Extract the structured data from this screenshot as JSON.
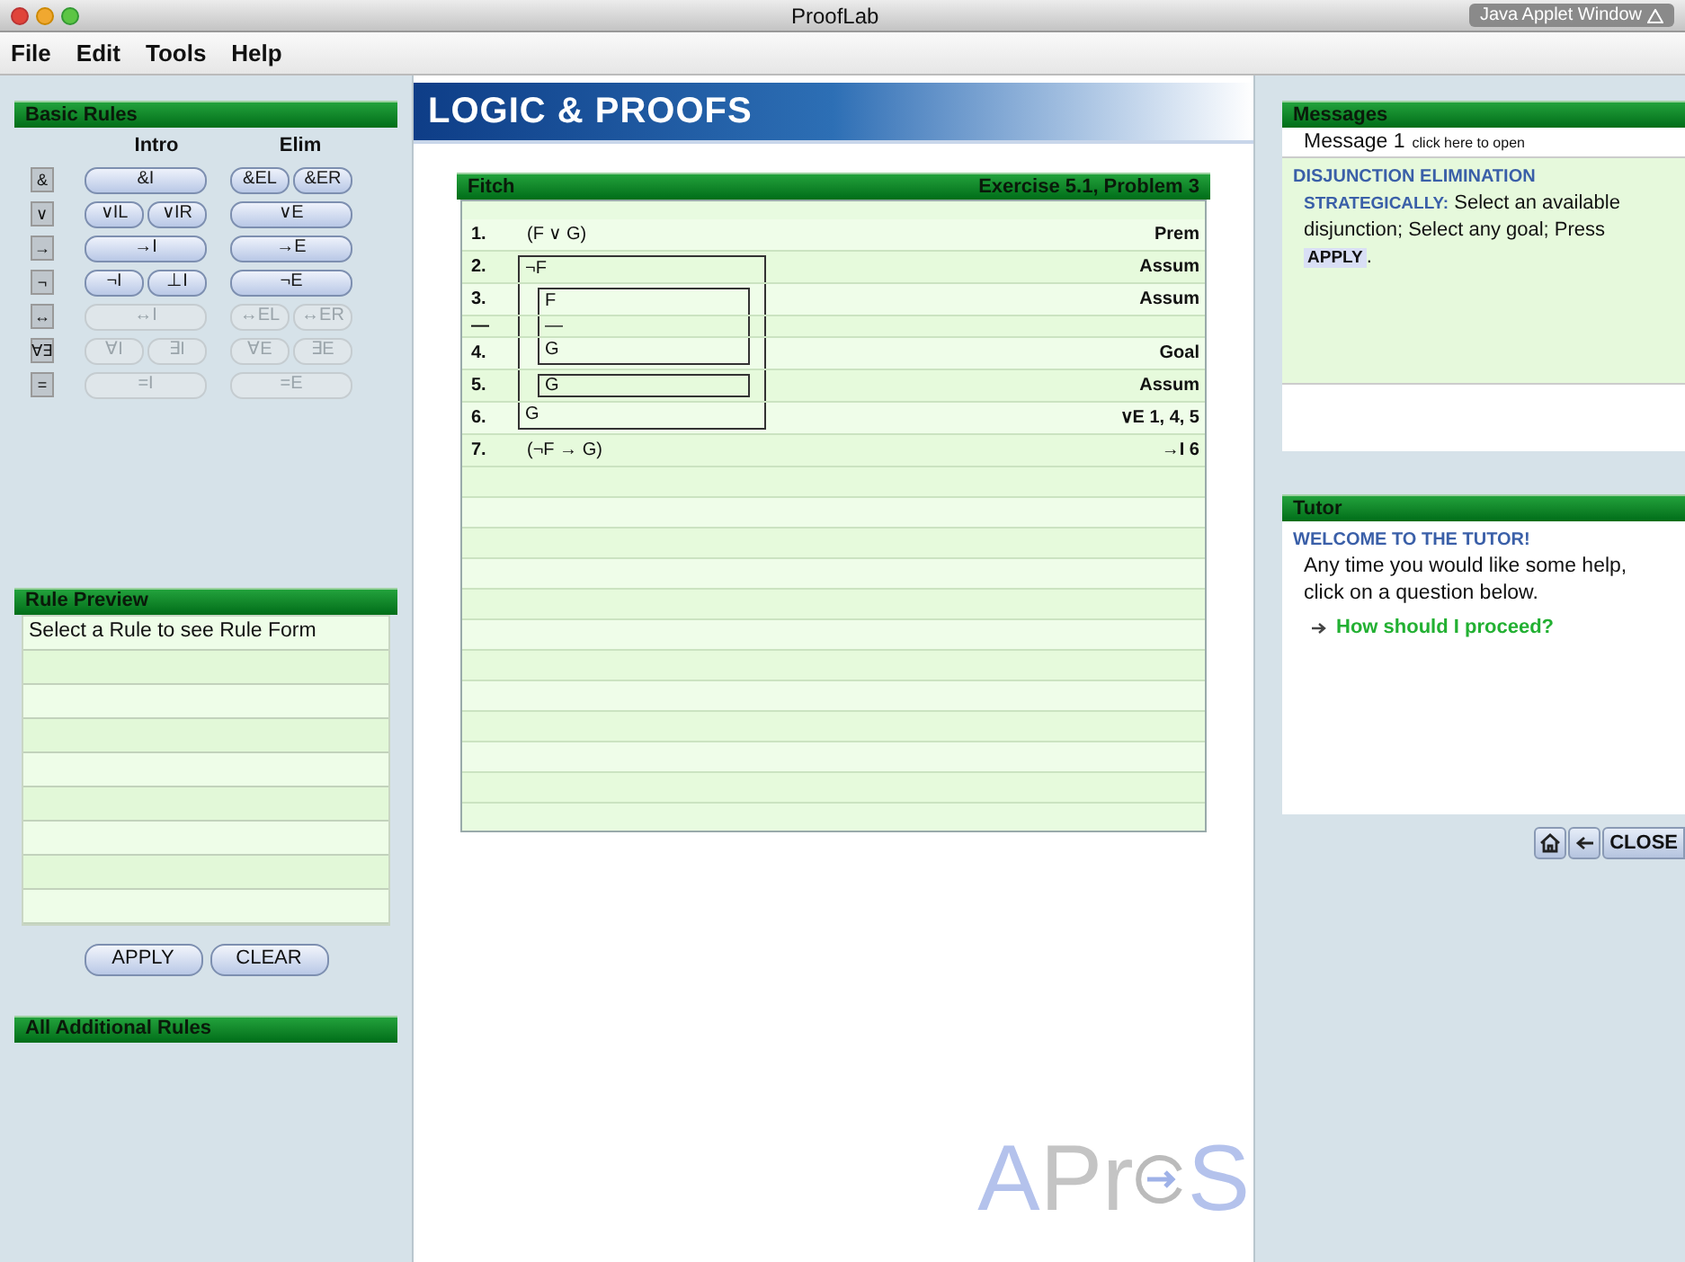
{
  "window": {
    "title": "ProofLab",
    "applet_label": "Java Applet Window"
  },
  "menu": [
    "File",
    "Edit",
    "Tools",
    "Help"
  ],
  "basic_rules": {
    "title": "Basic Rules",
    "intro_heading": "Intro",
    "elim_heading": "Elim",
    "rows": [
      {
        "symbol": "&",
        "intro": [
          "&I"
        ],
        "elim": [
          "&EL",
          "&ER"
        ],
        "disabled": false
      },
      {
        "symbol": "∨",
        "intro": [
          "∨IL",
          "∨IR"
        ],
        "elim": [
          "∨E"
        ],
        "disabled": false
      },
      {
        "symbol": "→",
        "intro": [
          "→I"
        ],
        "elim": [
          "→E"
        ],
        "disabled": false
      },
      {
        "symbol": "¬",
        "intro": [
          "¬I",
          "⊥I"
        ],
        "elim": [
          "¬E"
        ],
        "disabled": false
      },
      {
        "symbol": "↔",
        "intro": [
          "↔I"
        ],
        "elim": [
          "↔EL",
          "↔ER"
        ],
        "disabled": true
      },
      {
        "symbol": "∀∃",
        "intro": [
          "∀I",
          "∃I"
        ],
        "elim": [
          "∀E",
          "∃E"
        ],
        "disabled": true
      },
      {
        "symbol": "=",
        "intro": [
          "=I"
        ],
        "elim": [
          "=E"
        ],
        "disabled": true
      }
    ]
  },
  "rule_preview": {
    "title": "Rule Preview",
    "text": "Select a Rule to see Rule Form"
  },
  "buttons": [
    "APPLY",
    "CLEAR"
  ],
  "additional_rules": {
    "title": "All Additional Rules"
  },
  "banner": {
    "title": "LOGIC & PROOFS"
  },
  "fitch": {
    "title": "Fitch",
    "exercise": "Exercise 5.1, Problem 3",
    "proof": [
      {
        "kind": "line",
        "num": "1.",
        "formula": "(F ∨ G)",
        "rule": "Prem"
      },
      {
        "kind": "subproof",
        "children": [
          {
            "kind": "line",
            "num": "2.",
            "formula": "¬F",
            "rule": "Assum"
          },
          {
            "kind": "subproof",
            "children": [
              {
                "kind": "line",
                "num": "3.",
                "formula": "F",
                "rule": "Assum"
              },
              {
                "kind": "gap",
                "num": "—",
                "formula": "—"
              },
              {
                "kind": "line",
                "num": "4.",
                "formula": "G",
                "rule": "Goal"
              }
            ]
          },
          {
            "kind": "subproof",
            "children": [
              {
                "kind": "line",
                "num": "5.",
                "formula": "G",
                "rule": "Assum"
              }
            ]
          },
          {
            "kind": "line",
            "num": "6.",
            "formula": "G",
            "rule": "∨E 1, 4, 5"
          }
        ]
      },
      {
        "kind": "line",
        "num": "7.",
        "formula": "(¬F → G)",
        "rule": "→I 6"
      }
    ]
  },
  "brand": {
    "before": "APr",
    "after": "S"
  },
  "messages": {
    "title": "Messages",
    "message": "Message 1",
    "message_hint": "click here to open",
    "heading": "DISJUNCTION ELIMINATION",
    "label": "STRATEGICALLY:",
    "text": "Select an available disjunction; Select any goal; Press",
    "chip": "APPLY",
    "end": "."
  },
  "tutor": {
    "title": "Tutor",
    "heading": "WELCOME TO THE TUTOR!",
    "text": "Any time you would like some help, click on a question below.",
    "question": "How should I proceed?",
    "close": "CLOSE"
  }
}
